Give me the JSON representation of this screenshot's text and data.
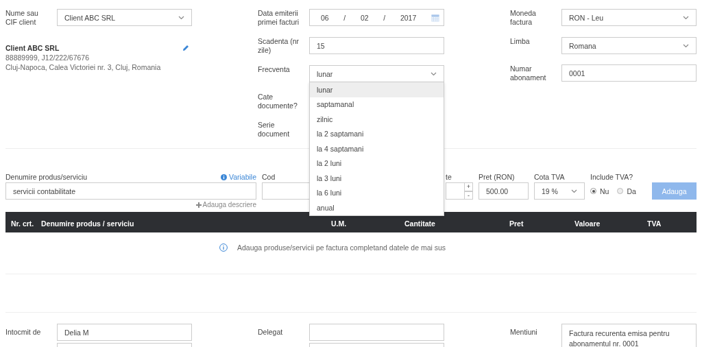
{
  "client": {
    "label": "Nume sau CIF client",
    "value": "Client ABC SRL",
    "card": {
      "name": "Client ABC SRL",
      "ids": "88889999, J12/222/67676",
      "address": "Cluj-Napoca, Calea Victoriei nr. 3, Cluj, Romania"
    }
  },
  "invoice_fields": [
    {
      "kind": "date",
      "label": "Data emiterii primei facturi",
      "parts": [
        "06",
        "/",
        "02",
        "/",
        "2017"
      ]
    },
    {
      "kind": "input",
      "label": "Scadenta (nr zile)",
      "value": "15"
    },
    {
      "kind": "select",
      "label": "Frecventa",
      "value": "lunar",
      "expanded": true,
      "options": [
        {
          "label": "lunar",
          "selected": true
        },
        {
          "label": "saptamanal",
          "selected": false
        },
        {
          "label": "zilnic",
          "selected": false
        },
        {
          "label": "la 2 saptamani",
          "selected": false
        },
        {
          "label": "la 4 saptamani",
          "selected": false
        },
        {
          "label": "la 2 luni",
          "selected": false
        },
        {
          "label": "la 3 luni",
          "selected": false
        },
        {
          "label": "la 6 luni",
          "selected": false
        },
        {
          "label": "anual",
          "selected": false
        }
      ]
    },
    {
      "kind": "label",
      "label": "Cate documente?"
    },
    {
      "kind": "label",
      "label": "Serie document"
    }
  ],
  "settings_fields": [
    {
      "kind": "select",
      "label": "Moneda factura",
      "value": "RON - Leu"
    },
    {
      "kind": "select",
      "label": "Limba",
      "value": "Romana"
    },
    {
      "kind": "input",
      "label": "Numar abonament",
      "value": "0001"
    }
  ],
  "product_form": {
    "name_label": "Denumire produs/serviciu",
    "variables_link": "Variabile",
    "name_value": "servicii contabilitate",
    "add_description": "Adauga descriere",
    "code_label": "Cod",
    "quantity_label": "te",
    "quantity_plus": "+",
    "quantity_minus": "-",
    "price_label": "Pret (RON)",
    "price_value": "500.00",
    "vat_label": "Cota TVA",
    "vat_value": "19 %",
    "include_vat_label": "Include TVA?",
    "include_vat_options": [
      {
        "label": "Nu",
        "selected": true
      },
      {
        "label": "Da",
        "selected": false
      }
    ],
    "add_button": {
      "label": "Adauga",
      "disabled": true
    }
  },
  "table": {
    "columns": [
      "Nr. crt.",
      "Denumire produs / serviciu",
      "U.M.",
      "Cantitate",
      "Pret",
      "Valoare",
      "TVA"
    ],
    "empty_message": "Adauga produse/servicii pe factura completand datele de mai sus"
  },
  "footer_fields": [
    {
      "kind": "input",
      "label": "Intocmit de",
      "value": "Delia M"
    },
    {
      "kind": "input",
      "label": "Delegat"
    },
    {
      "kind": "textarea",
      "label": "Mentiuni",
      "value": "Factura recurenta emisa pentru abonamentul nr. 0001"
    }
  ],
  "footer_fields_row2": [
    {
      "kind": "input"
    },
    {
      "kind": "input"
    }
  ]
}
